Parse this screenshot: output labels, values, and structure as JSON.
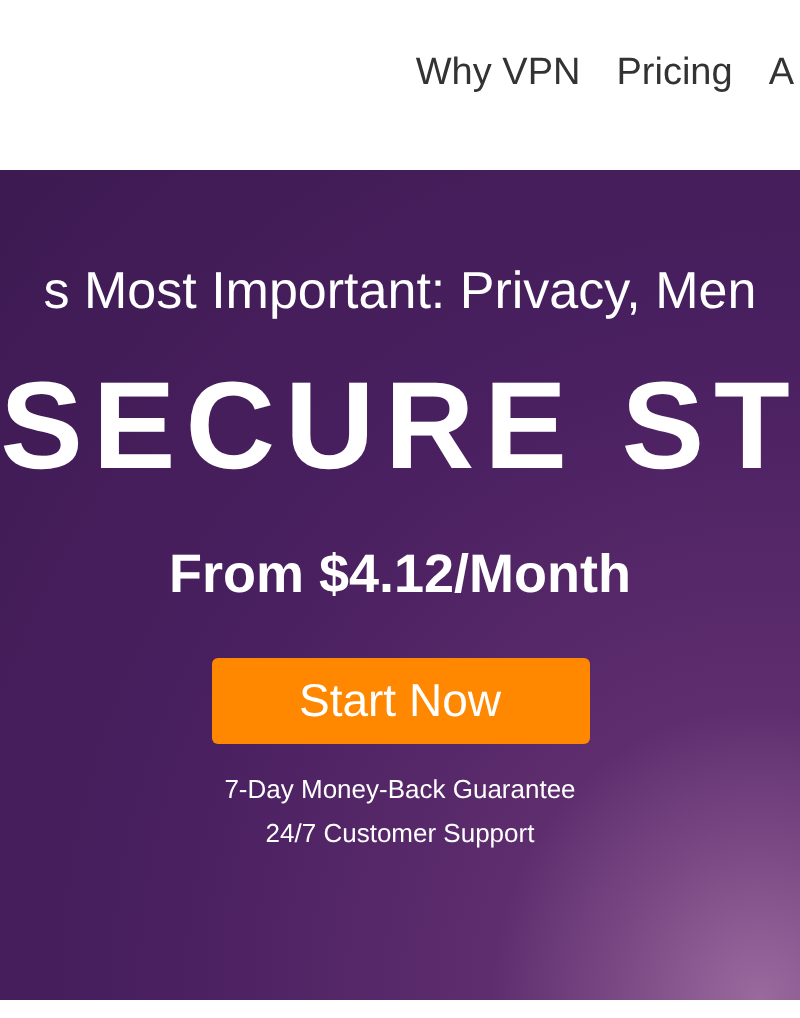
{
  "nav": {
    "items": [
      {
        "label": "Why VPN"
      },
      {
        "label": "Pricing"
      },
      {
        "label": "A"
      }
    ]
  },
  "hero": {
    "tagline": "s Most Important: Privacy, Men",
    "headline": "SECURE ST",
    "price": "From $4.12/Month",
    "cta": "Start Now",
    "perks": [
      "7-Day Money-Back Guarantee",
      "24/7 Customer Support"
    ]
  }
}
